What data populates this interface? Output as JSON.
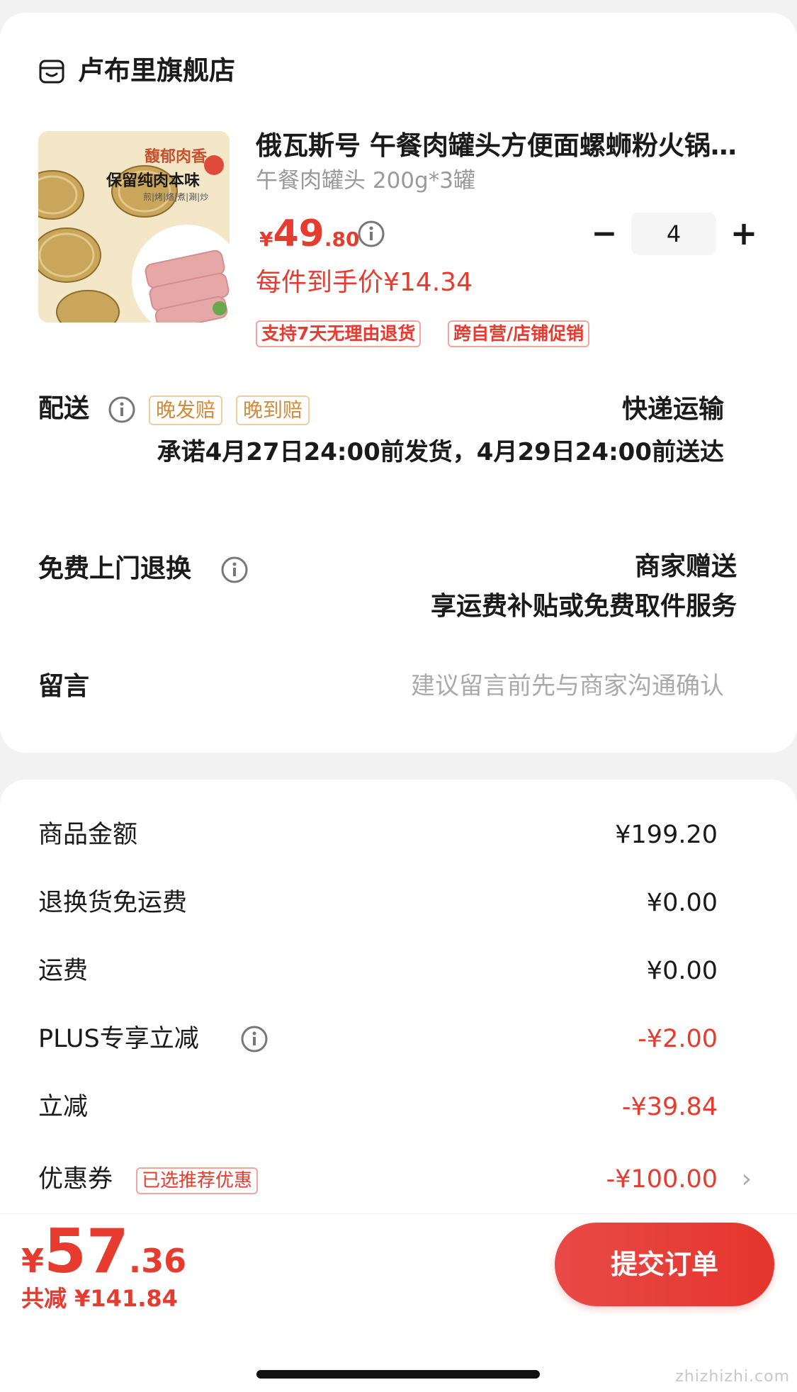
{
  "store": {
    "name": "卢布里旗舰店",
    "icon": "store-icon"
  },
  "product": {
    "title": "俄瓦斯号 午餐肉罐头方便面螺蛳粉火锅食材",
    "spec": "午餐肉罐头 200g*3罐",
    "image_text": {
      "headline": "馥郁肉香",
      "subline": "保留纯肉本味",
      "footline": "煎|烤|烙|煮|涮|炒"
    },
    "price": {
      "currency": "¥",
      "integer": "49",
      "decimal": ".80"
    },
    "quantity": "4",
    "quantity_minus": "−",
    "quantity_plus": "+",
    "unit_price_text": "每件到手价¥14.34",
    "tags": [
      "支持7天无理由退货",
      "跨自营/店铺促销"
    ]
  },
  "delivery": {
    "label": "配送",
    "badges": [
      "晚发赔",
      "晚到赔"
    ],
    "method": "快递运输",
    "promise": "承诺4月27日24:00前发货，4月29日24:00前送达"
  },
  "returns": {
    "label": "免费上门退换",
    "line1": "商家赠送",
    "line2": "享运费补贴或免费取件服务"
  },
  "message": {
    "label": "留言",
    "placeholder": "建议留言前先与商家沟通确认"
  },
  "summary": {
    "rows": [
      {
        "label": "商品金额",
        "value": "¥199.20"
      },
      {
        "label": "退换货免运费",
        "value": "¥0.00"
      },
      {
        "label": "运费",
        "value": "¥0.00"
      },
      {
        "label": "PLUS专享立减",
        "value": "-¥2.00"
      },
      {
        "label": "立减",
        "value": "-¥39.84"
      },
      {
        "label": "优惠券",
        "value": "-¥100.00"
      }
    ],
    "coupon_tag": "已选推荐优惠"
  },
  "footer": {
    "total": {
      "currency": "¥",
      "integer": "57",
      "decimal": ".36"
    },
    "saved_text": "共减 ¥141.84",
    "submit_label": "提交订单"
  },
  "watermark": "zhizhizhi.com",
  "colors": {
    "accent_red": "#e63b2e",
    "orange_tag": "#d08a3a",
    "background": "#f2f2f2"
  }
}
